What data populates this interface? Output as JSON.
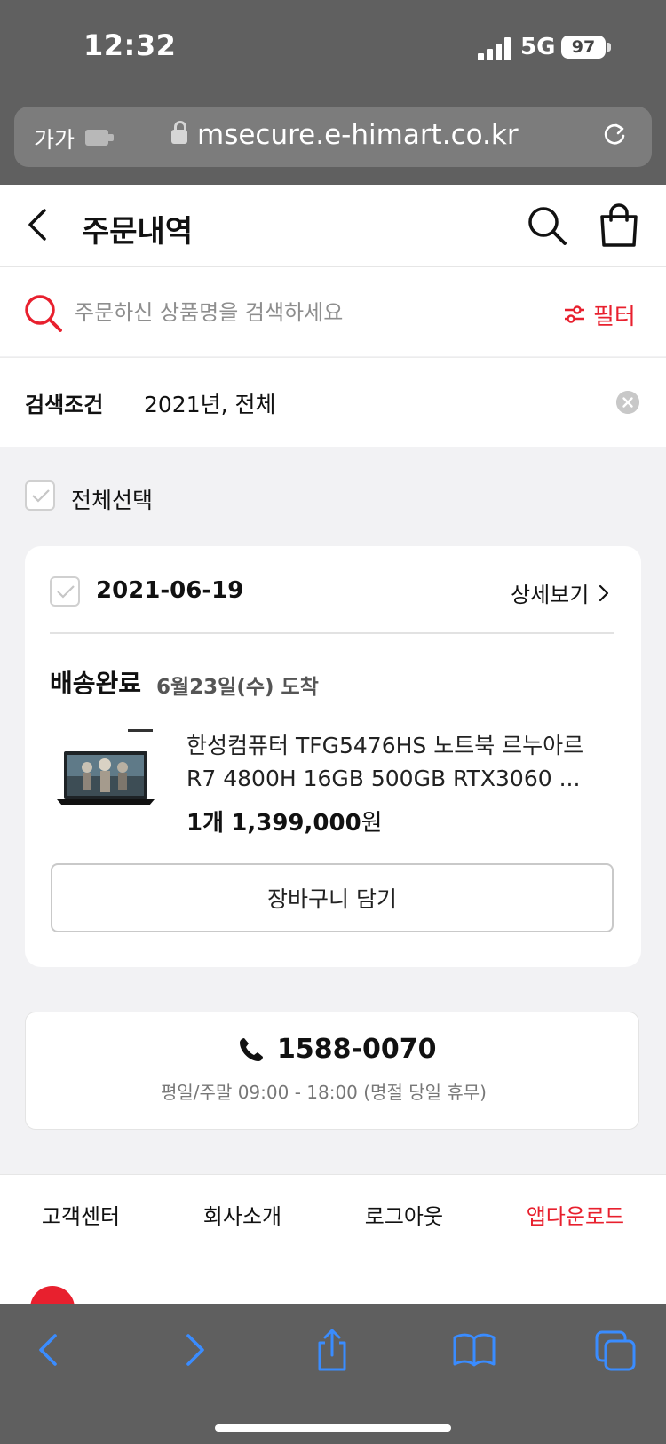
{
  "status_bar": {
    "time": "12:32",
    "network": "5G",
    "battery": "97"
  },
  "browser": {
    "aa_label": "가가",
    "url": "msecure.e-himart.co.kr"
  },
  "header": {
    "title": "주문내역"
  },
  "search": {
    "placeholder": "주문하신 상품명을 검색하세요",
    "filter_label": "필터"
  },
  "condition": {
    "label": "검색조건",
    "value": "2021년, 전체"
  },
  "select_all": {
    "label": "전체선택"
  },
  "order": {
    "date": "2021-06-19",
    "detail_label": "상세보기",
    "status": "배송완료",
    "arrival": "6월23일(수) 도착",
    "product_name_line1": "한성컴퓨터 TFG5476HS 노트북 르누아르",
    "product_name_line2": "R7 4800H 16GB 500GB RTX3060 ...",
    "quantity": "1개",
    "price": "1,399,000",
    "price_unit": "원",
    "cart_button": "장바구니 담기"
  },
  "contact": {
    "phone": "1588-0070",
    "hours": "평일/주말 09:00 - 18:00 (명절 당일 휴무)"
  },
  "footer": {
    "links": [
      "고객센터",
      "회사소개",
      "로그아웃",
      "앱다운로드"
    ]
  },
  "colors": {
    "accent": "#e8202e",
    "background": "#f2f2f4"
  }
}
